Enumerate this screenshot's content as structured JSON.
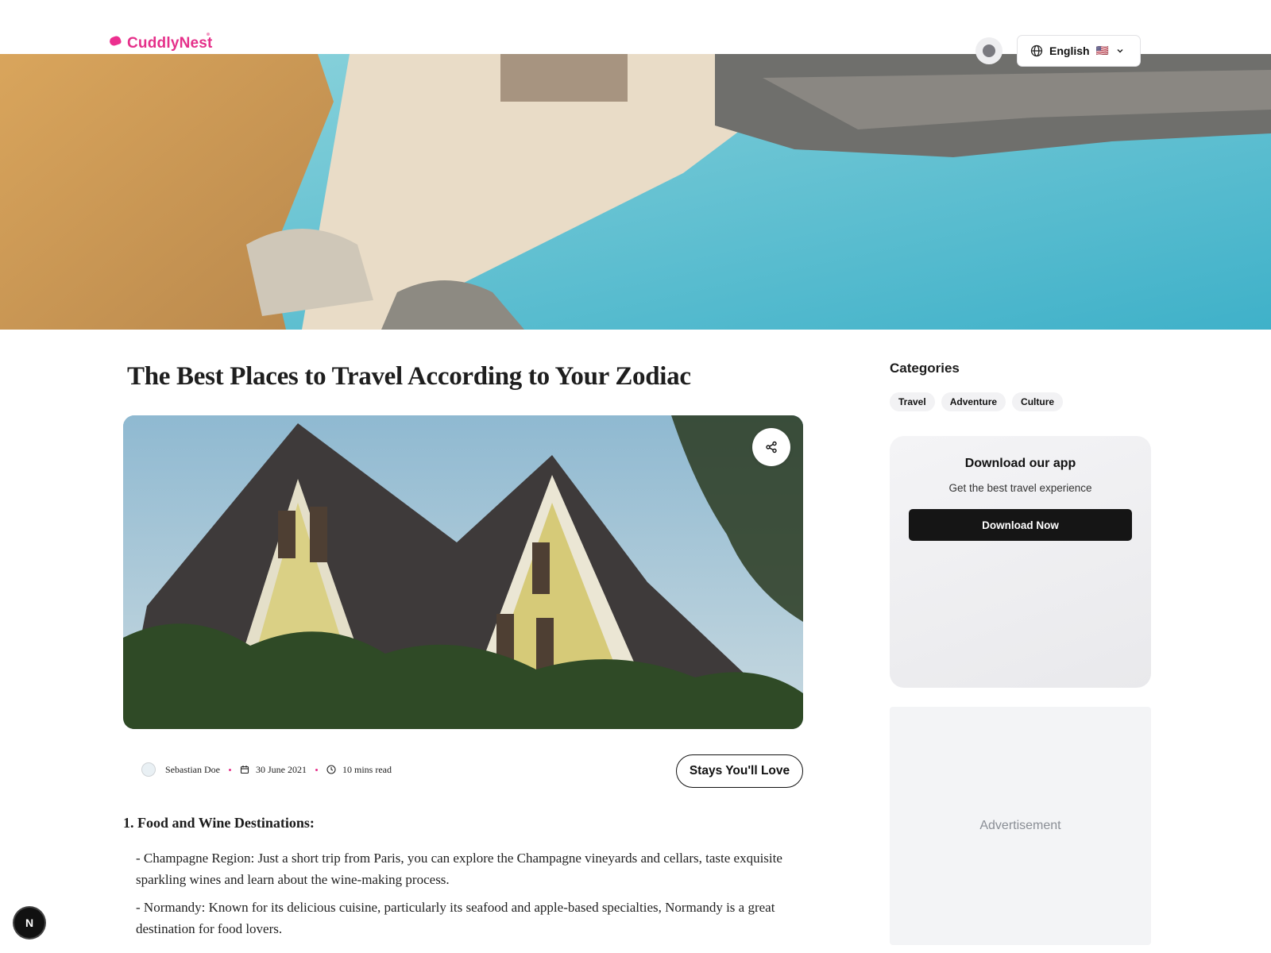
{
  "header": {
    "logo_text": "CuddlyNest",
    "language": "English",
    "flag": "🇺🇸"
  },
  "article": {
    "title": "The Best Places to Travel According to Your Zodiac",
    "author": "Sebastian Doe",
    "date": "30 June 2021",
    "read_time": "10 mins read",
    "stays_button": "Stays You'll Love",
    "section_heading": "1. Food and Wine Destinations:",
    "paragraphs": [
      "- Champagne Region: Just a short trip from Paris, you can explore the Champagne vineyards and cellars, taste exquisite sparkling wines and learn about the wine-making process.",
      "- Normandy: Known for its delicious cuisine, particularly its seafood and apple-based specialties, Normandy is a great destination for food lovers."
    ]
  },
  "sidebar": {
    "categories_title": "Categories",
    "categories": [
      "Travel",
      "Adventure",
      "Culture"
    ],
    "app_card": {
      "title": "Download our app",
      "subtitle": "Get the best travel experience",
      "button": "Download Now"
    },
    "ad_label": "Advertisement"
  },
  "dev_badge": "N",
  "icons": {
    "globe": "globe-icon",
    "chevron": "chevron-down-icon",
    "share": "share-icon",
    "calendar": "calendar-icon",
    "clock": "clock-icon"
  },
  "colors": {
    "brand": "#e5308a",
    "button_dark": "#151515"
  }
}
